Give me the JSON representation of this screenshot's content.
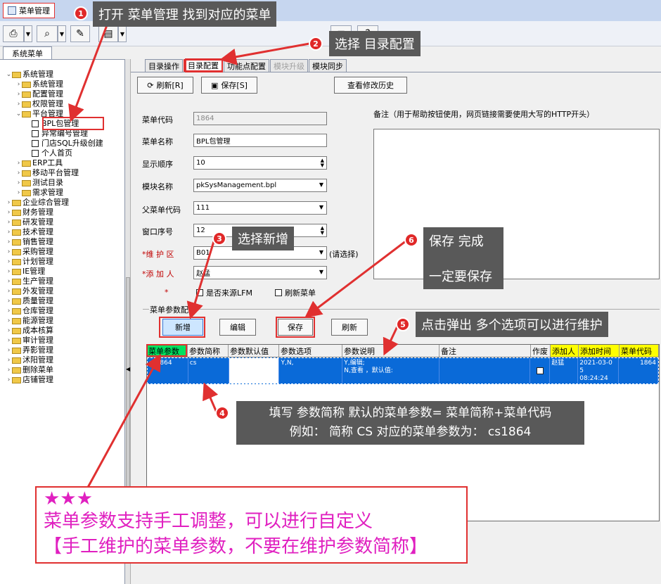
{
  "window": {
    "tab_label": "菜单管理"
  },
  "left": {
    "tab_label": "系统菜单",
    "tree": [
      {
        "label": "系统管理",
        "level": 0,
        "type": "folder",
        "expanded": true
      },
      {
        "label": "系统管理",
        "level": 1,
        "type": "folder"
      },
      {
        "label": "配置管理",
        "level": 1,
        "type": "folder"
      },
      {
        "label": "权限管理",
        "level": 1,
        "type": "folder"
      },
      {
        "label": "平台管理",
        "level": 1,
        "type": "folder",
        "expanded": true
      },
      {
        "label": "BPL包管理",
        "level": 2,
        "type": "item",
        "selected": true
      },
      {
        "label": "异常编号管理",
        "level": 2,
        "type": "item"
      },
      {
        "label": "门店SQL升级创建",
        "level": 2,
        "type": "item"
      },
      {
        "label": "个人首页",
        "level": 2,
        "type": "item"
      },
      {
        "label": "ERP工具",
        "level": 1,
        "type": "folder"
      },
      {
        "label": "移动平台管理",
        "level": 1,
        "type": "folder"
      },
      {
        "label": "测试目录",
        "level": 1,
        "type": "folder"
      },
      {
        "label": "需求管理",
        "level": 1,
        "type": "folder"
      },
      {
        "label": "企业综合管理",
        "level": 0,
        "type": "folder"
      },
      {
        "label": "财务管理",
        "level": 0,
        "type": "folder"
      },
      {
        "label": "研发管理",
        "level": 0,
        "type": "folder"
      },
      {
        "label": "技术管理",
        "level": 0,
        "type": "folder"
      },
      {
        "label": "销售管理",
        "level": 0,
        "type": "folder"
      },
      {
        "label": "采购管理",
        "level": 0,
        "type": "folder"
      },
      {
        "label": "计划管理",
        "level": 0,
        "type": "folder"
      },
      {
        "label": "IE管理",
        "level": 0,
        "type": "folder"
      },
      {
        "label": "生产管理",
        "level": 0,
        "type": "folder"
      },
      {
        "label": "外发管理",
        "level": 0,
        "type": "folder"
      },
      {
        "label": "质量管理",
        "level": 0,
        "type": "folder"
      },
      {
        "label": "仓库管理",
        "level": 0,
        "type": "folder"
      },
      {
        "label": "能源管理",
        "level": 0,
        "type": "folder"
      },
      {
        "label": "成本核算",
        "level": 0,
        "type": "folder"
      },
      {
        "label": "审计管理",
        "level": 0,
        "type": "folder"
      },
      {
        "label": "弄影管理",
        "level": 0,
        "type": "folder"
      },
      {
        "label": "沭阳管理",
        "level": 0,
        "type": "folder"
      },
      {
        "label": "删除菜单",
        "level": 0,
        "type": "folder"
      },
      {
        "label": "店铺管理",
        "level": 0,
        "type": "folder"
      }
    ]
  },
  "tabs": [
    {
      "label": "目录操作"
    },
    {
      "label": "目录配置",
      "active": true
    },
    {
      "label": "功能点配置"
    },
    {
      "label": "模块升级",
      "disabled": true
    },
    {
      "label": "模块同步"
    }
  ],
  "toolbar": {
    "refresh": "刷新[R]",
    "save": "保存[S]",
    "history": "查看修改历史"
  },
  "form": {
    "code_label": "菜单代码",
    "code_value": "1864",
    "name_label": "菜单名称",
    "name_value": "BPL包管理",
    "order_label": "显示顺序",
    "order_value": "10",
    "module_label": "模块名称",
    "module_value": "pkSysManagement.bpl",
    "parent_label": "父菜单代码",
    "parent_value": "111",
    "window_label": "窗口序号",
    "window_value": "12",
    "area_label": "*维 护 区",
    "area_value": "B01",
    "area_hint": "(请选择)",
    "adder_label": "*添 加 人",
    "adder_value": "赵猛",
    "star": "*",
    "lfm_label": "是否来源LFM",
    "refresh_menu_label": "刷新菜单",
    "note_label": "备注（用于帮助按钮使用，网页链接需要使用大写的HTTP开头）"
  },
  "params": {
    "section_label": "菜单参数配置",
    "buttons": {
      "add": "新增",
      "edit": "编辑",
      "save": "保存",
      "refresh": "刷新"
    },
    "columns": [
      "菜单参数",
      "参数简称",
      "参数默认值",
      "参数选项",
      "参数说明",
      "备注",
      "作废",
      "添加人",
      "添加时间",
      "菜单代码"
    ],
    "rows": [
      {
        "param": "cs1864",
        "short": "cs",
        "default": "",
        "options": "Y,N,",
        "desc": "Y,编辑;\nN,查看 ，默认值:",
        "note": "",
        "void": false,
        "adder": "赵猛",
        "time": "2021-03-0\n5\n08:24:24",
        "code": "1864"
      }
    ]
  },
  "annotations": {
    "c1": "打开  菜单管理  找到对应的菜单",
    "c2": "选择  目录配置",
    "c3": "选择新增",
    "c4_line1": "填写  参数简称    默认的菜单参数=  菜单简称+菜单代码",
    "c4_line2": "例如：   简称 CS    对应的菜单参数为：  cs1864",
    "c5": "点击弹出 多个选项可以进行维护",
    "c6_line1": "保存  完成",
    "c6_line2": "一定要保存",
    "n1": "1",
    "n2": "2",
    "n3": "3",
    "n4": "4",
    "n5": "5",
    "n6": "6",
    "note_stars": "★★★",
    "note_line1": "菜单参数支持手工调整，可以进行自定义",
    "note_line2": "【手工维护的菜单参数，不要在维护参数简称】",
    "annotation_color": "#e03030",
    "note_color": "#e020c0"
  }
}
